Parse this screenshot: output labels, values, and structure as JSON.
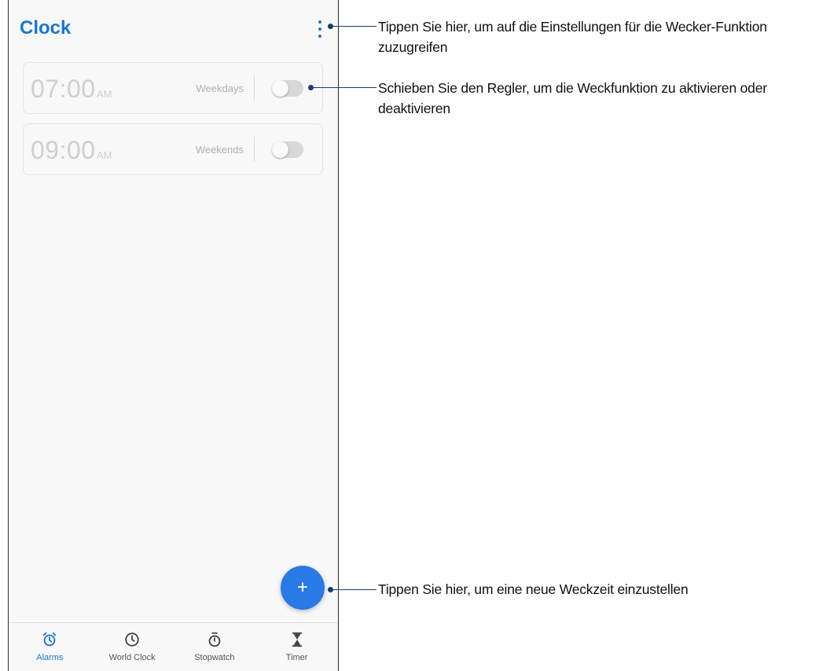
{
  "app": {
    "title": "Clock"
  },
  "header": {
    "menu_icon": "more-vert-icon"
  },
  "alarms": [
    {
      "time": "07:00",
      "ampm": "AM",
      "days": "Weekdays",
      "enabled": false
    },
    {
      "time": "09:00",
      "ampm": "AM",
      "days": "Weekends",
      "enabled": false
    }
  ],
  "fab": {
    "label": "+",
    "icon": "plus-icon"
  },
  "bottom_nav": [
    {
      "label": "Alarms",
      "icon": "alarm-icon",
      "active": true
    },
    {
      "label": "World Clock",
      "icon": "clock-icon",
      "active": false
    },
    {
      "label": "Stopwatch",
      "icon": "stopwatch-icon",
      "active": false
    },
    {
      "label": "Timer",
      "icon": "hourglass-icon",
      "active": false
    }
  ],
  "callouts": [
    "Tippen Sie hier, um auf die Einstellungen für die Wecker-Funktion zuzugreifen",
    "Schieben Sie den Regler, um die Weckfunktion zu aktivieren oder deaktivieren",
    "Tippen Sie hier, um eine neue Weckzeit einzustellen"
  ],
  "colors": {
    "accent": "#1976d2",
    "fab": "#2979e6",
    "callout_line": "#1a3d6e",
    "toggle_off": "#d8d8d8"
  }
}
